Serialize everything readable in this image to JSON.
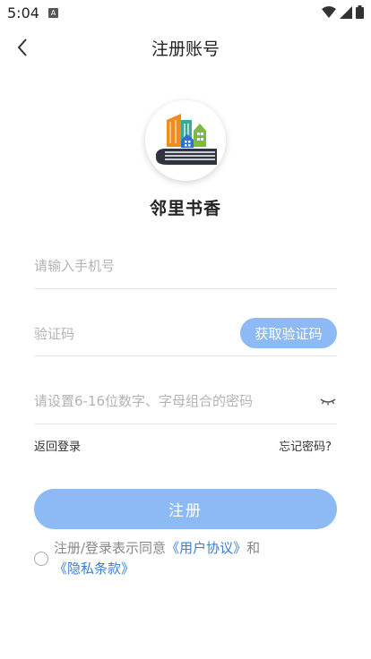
{
  "status_bar": {
    "time": "5:04",
    "notif_letter": "A"
  },
  "nav": {
    "title": "注册账号"
  },
  "app": {
    "name": "邻里书香"
  },
  "form": {
    "phone_placeholder": "请输入手机号",
    "code_placeholder": "验证码",
    "get_code_label": "获取验证码",
    "password_placeholder": "请设置6-16位数字、字母组合的密码"
  },
  "links": {
    "back_login": "返回登录",
    "forgot_password": "忘记密码?"
  },
  "register": {
    "label": "注册"
  },
  "agreement": {
    "prefix": "注册/登录表示同意",
    "user_agreement": "《用户协议》",
    "and": "和",
    "privacy": "《隐私条款》"
  },
  "colors": {
    "primary_light": "#8dbaf5",
    "link": "#3a7fd5"
  },
  "icons": [
    "back-arrow-icon",
    "wifi-icon",
    "signal-icon",
    "battery-icon",
    "eye-closed-icon",
    "app-logo-icon"
  ]
}
